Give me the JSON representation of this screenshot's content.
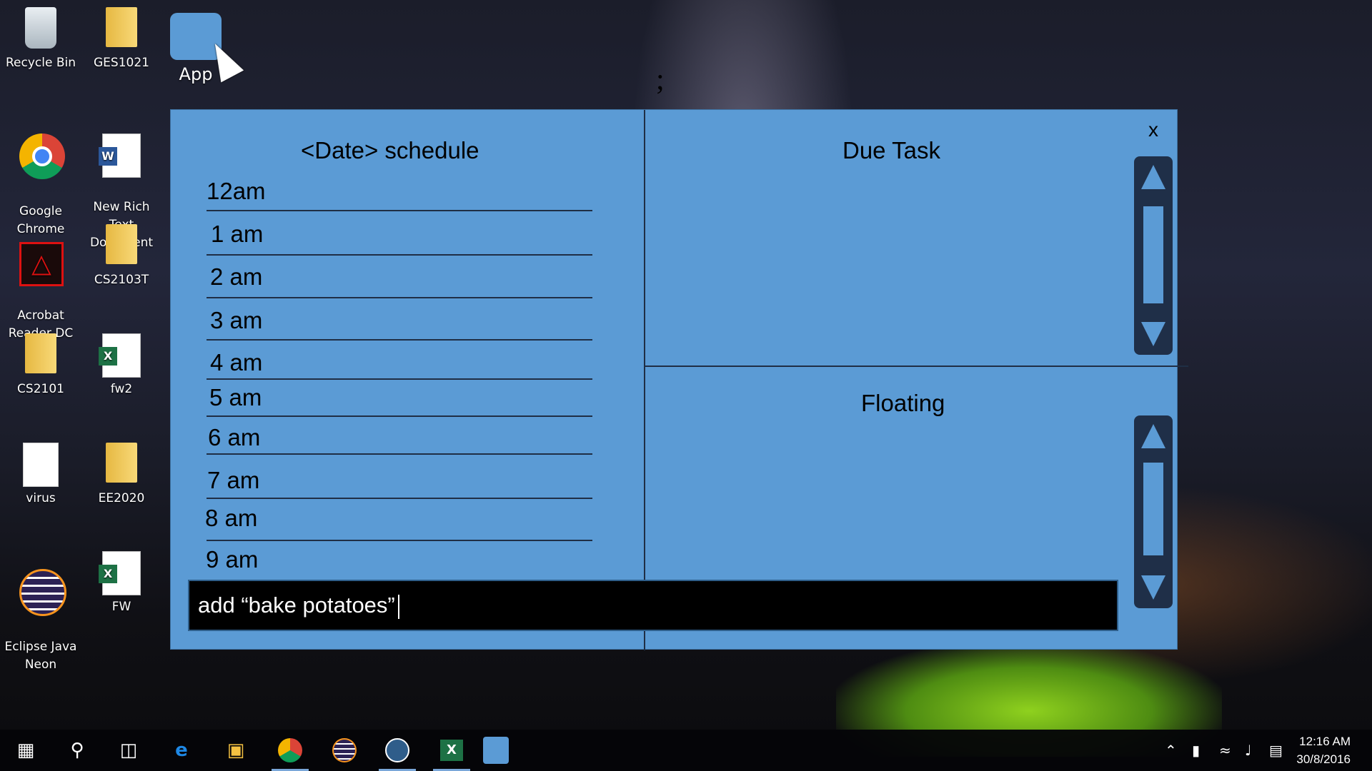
{
  "desktop": {
    "icons": [
      {
        "label": "Recycle Bin",
        "icon": "recycle-bin-icon"
      },
      {
        "label": "GES1021",
        "icon": "folder-icon"
      },
      {
        "label": "App",
        "icon": "app-icon"
      },
      {
        "label": "Google\nChrome",
        "icon": "chrome-icon"
      },
      {
        "label": "New Rich Text\nDocument",
        "icon": "word-document-icon"
      },
      {
        "label": "Acrobat\nReader DC",
        "icon": "acrobat-icon"
      },
      {
        "label": "CS2103T",
        "icon": "folder-icon"
      },
      {
        "label": "CS2101",
        "icon": "folder-icon"
      },
      {
        "label": "fw2",
        "icon": "excel-icon"
      },
      {
        "label": "virus",
        "icon": "document-icon"
      },
      {
        "label": "EE2020",
        "icon": "pdf-folder-icon"
      },
      {
        "label": "Eclipse Java\nNeon",
        "icon": "eclipse-icon"
      },
      {
        "label": "FW",
        "icon": "excel-icon"
      }
    ],
    "stray_text": ";"
  },
  "window": {
    "schedule_title": "<Date> schedule",
    "slots": [
      "12am",
      "1 am",
      "2 am",
      "3 am",
      "4 am",
      "5 am",
      "6 am",
      "7 am",
      "8 am",
      "9 am"
    ],
    "due_title": "Due Task",
    "floating_title": "Floating",
    "close_label": "x",
    "command": "add “bake potatoes”"
  },
  "taskbar": {
    "apps": [
      "start-icon",
      "search-icon",
      "task-view-icon",
      "edge-icon",
      "file-explorer-icon",
      "chrome-icon",
      "eclipse-icon",
      "app2-icon",
      "excel-icon",
      "app-icon"
    ],
    "time": "12:16 AM",
    "date": "30/8/2016"
  }
}
